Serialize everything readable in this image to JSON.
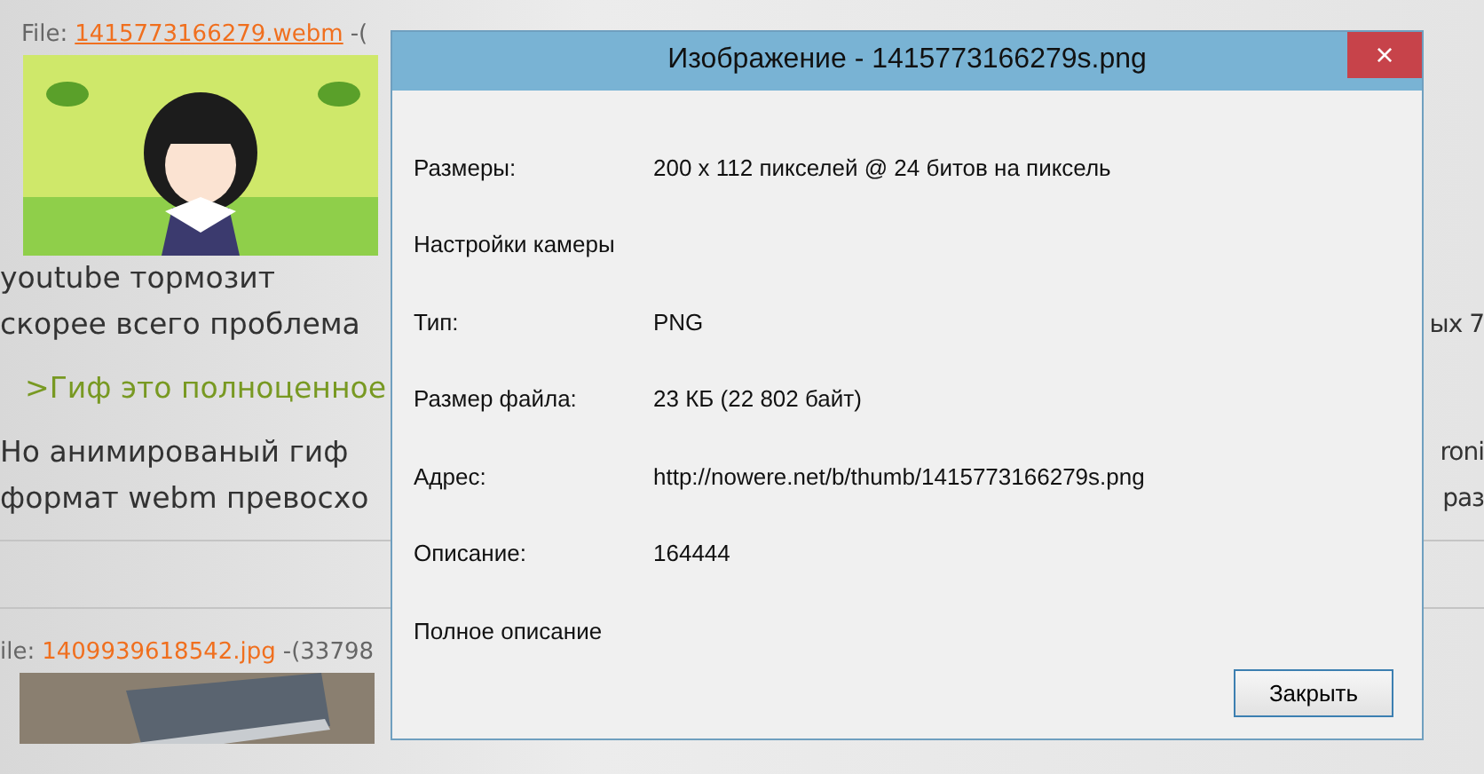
{
  "posts": [
    {
      "file_label": "File:",
      "file_link": "1415773166279.webm",
      "link_underlined": true,
      "file_info": "-(",
      "lines": [
        {
          "kind": "text",
          "left": "youtube тормозит"
        },
        {
          "kind": "text",
          "left": "скорее всего проблема",
          "right": "ых 7"
        },
        {
          "kind": "quote",
          "left": ">Гиф это полноценное"
        },
        {
          "kind": "text",
          "left": "Но анимированый гиф",
          "right": "roni"
        },
        {
          "kind": "text",
          "left": "формат webm превосхо",
          "right": "раз"
        }
      ]
    },
    {
      "file_label": "ile:",
      "file_link": "1409939618542.jpg",
      "link_underlined": false,
      "file_info": "-(33798"
    }
  ],
  "dialog": {
    "title": "Изображение - 1415773166279s.png",
    "close": "×",
    "rows": [
      {
        "label": "Размеры:",
        "value": "200 x 112 пикселей @ 24 битов на пиксель"
      },
      {
        "label": "Настройки камеры"
      },
      {
        "label": "Тип:",
        "value": "PNG"
      },
      {
        "label": "Размер файла:",
        "value": "23 КБ (22 802 байт)"
      },
      {
        "label": "Адрес:",
        "value": "http://nowere.net/b/thumb/1415773166279s.png"
      },
      {
        "label": "Описание:",
        "value": "164444"
      },
      {
        "label": "Полное описание"
      }
    ],
    "button": "Закрыть"
  }
}
